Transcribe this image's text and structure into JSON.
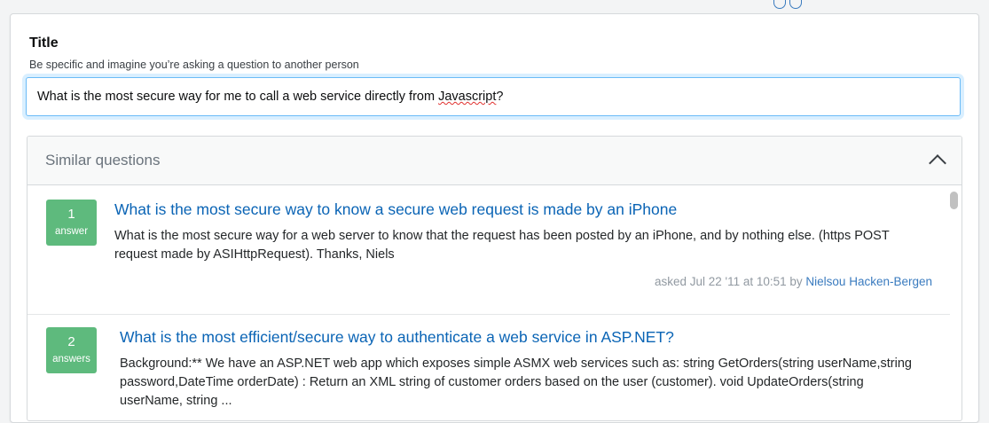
{
  "form": {
    "title_label": "Title",
    "title_help": "Be specific and imagine you’re asking a question to another person",
    "title_value_part1": "What is the most secure way for me to call a web service directly from ",
    "title_value_misspelled": "Javascript",
    "title_value_part2": "?"
  },
  "similar": {
    "header": "Similar questions",
    "chevron_icon": "chevron-up-icon",
    "questions": [
      {
        "count": "1",
        "count_label": "answer",
        "title": "What is the most secure way to know a secure web request is made by an iPhone",
        "excerpt": "What is the most secure way for a web server to know that the request has been posted by an iPhone, and by nothing else. (https POST request made by ASIHttpRequest). Thanks, Niels",
        "asked": "asked Jul 22 '11 at 10:51 by",
        "user": "Nielsou Hacken-Bergen"
      },
      {
        "count": "2",
        "count_label": "answers",
        "title": "What is the most efficient/secure way to authenticate a web service in ASP.NET?",
        "excerpt": "Background:** We have an ASP.NET web app which exposes simple ASMX web services such as: string GetOrders(string userName,string password,DateTime orderDate) : Return an XML string of customer orders based on the user (customer). void UpdateOrders(string userName, string ..."
      }
    ]
  },
  "colors": {
    "accent": "#0a64b5",
    "badge": "#5eba7d",
    "focus_border": "#6bbbf7"
  }
}
